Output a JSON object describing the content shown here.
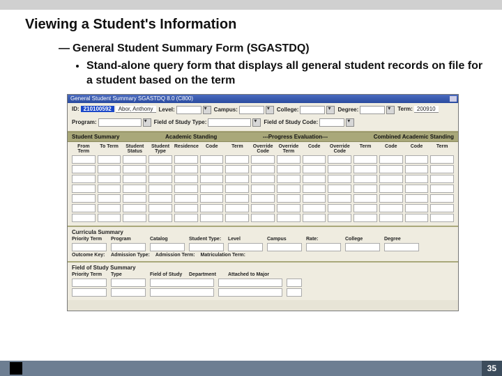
{
  "page": {
    "title": "Viewing a Student's Information",
    "section": "General Student Summary Form (SGASTDQ)",
    "bullet": "Stand-alone query form that displays all general student records on file for a student based on the term",
    "pagenum": "35"
  },
  "win": {
    "title": "General Student Summary SGASTDQ 8.0 (C800)",
    "header": {
      "id_label": "ID:",
      "id_value": "210100592",
      "name": "Abor, Anthony",
      "term_label": "Term:",
      "term_value": "200910",
      "program_label": "Program:",
      "level_label": "Level:",
      "campus_label": "Campus:",
      "college_label": "College:",
      "degree_label": "Degree:",
      "fos_type_label": "Field of Study Type:",
      "fos_code_label": "Field of Study Code:"
    },
    "summary": {
      "title": "Student Summary",
      "group_academic": "Academic Standing",
      "group_progress": "---Progress Evaluation---",
      "group_combined": "Combined Academic Standing",
      "cols": [
        "From Term",
        "To Term",
        "Student Status",
        "Student Type",
        "Residence",
        "Code",
        "Term",
        "Override Code",
        "Override Term",
        "Code",
        "Override Code",
        "Term",
        "Code",
        "Code",
        "Term"
      ]
    },
    "curric": {
      "title": "Curricula Summary",
      "labels": [
        "Priority Term",
        "Program",
        "Catalog",
        "Student Type:",
        "Level",
        "Campus",
        "Rate:",
        "College",
        "Degree"
      ],
      "row2": [
        "Outcome Key:",
        "Admission Type:",
        "Admission Term:",
        "Matriculation Term:"
      ]
    },
    "fos": {
      "title": "Field of Study Summary",
      "labels": [
        "Priority Term",
        "Type",
        "Field of Study",
        "Department",
        "Attached to Major"
      ]
    }
  }
}
